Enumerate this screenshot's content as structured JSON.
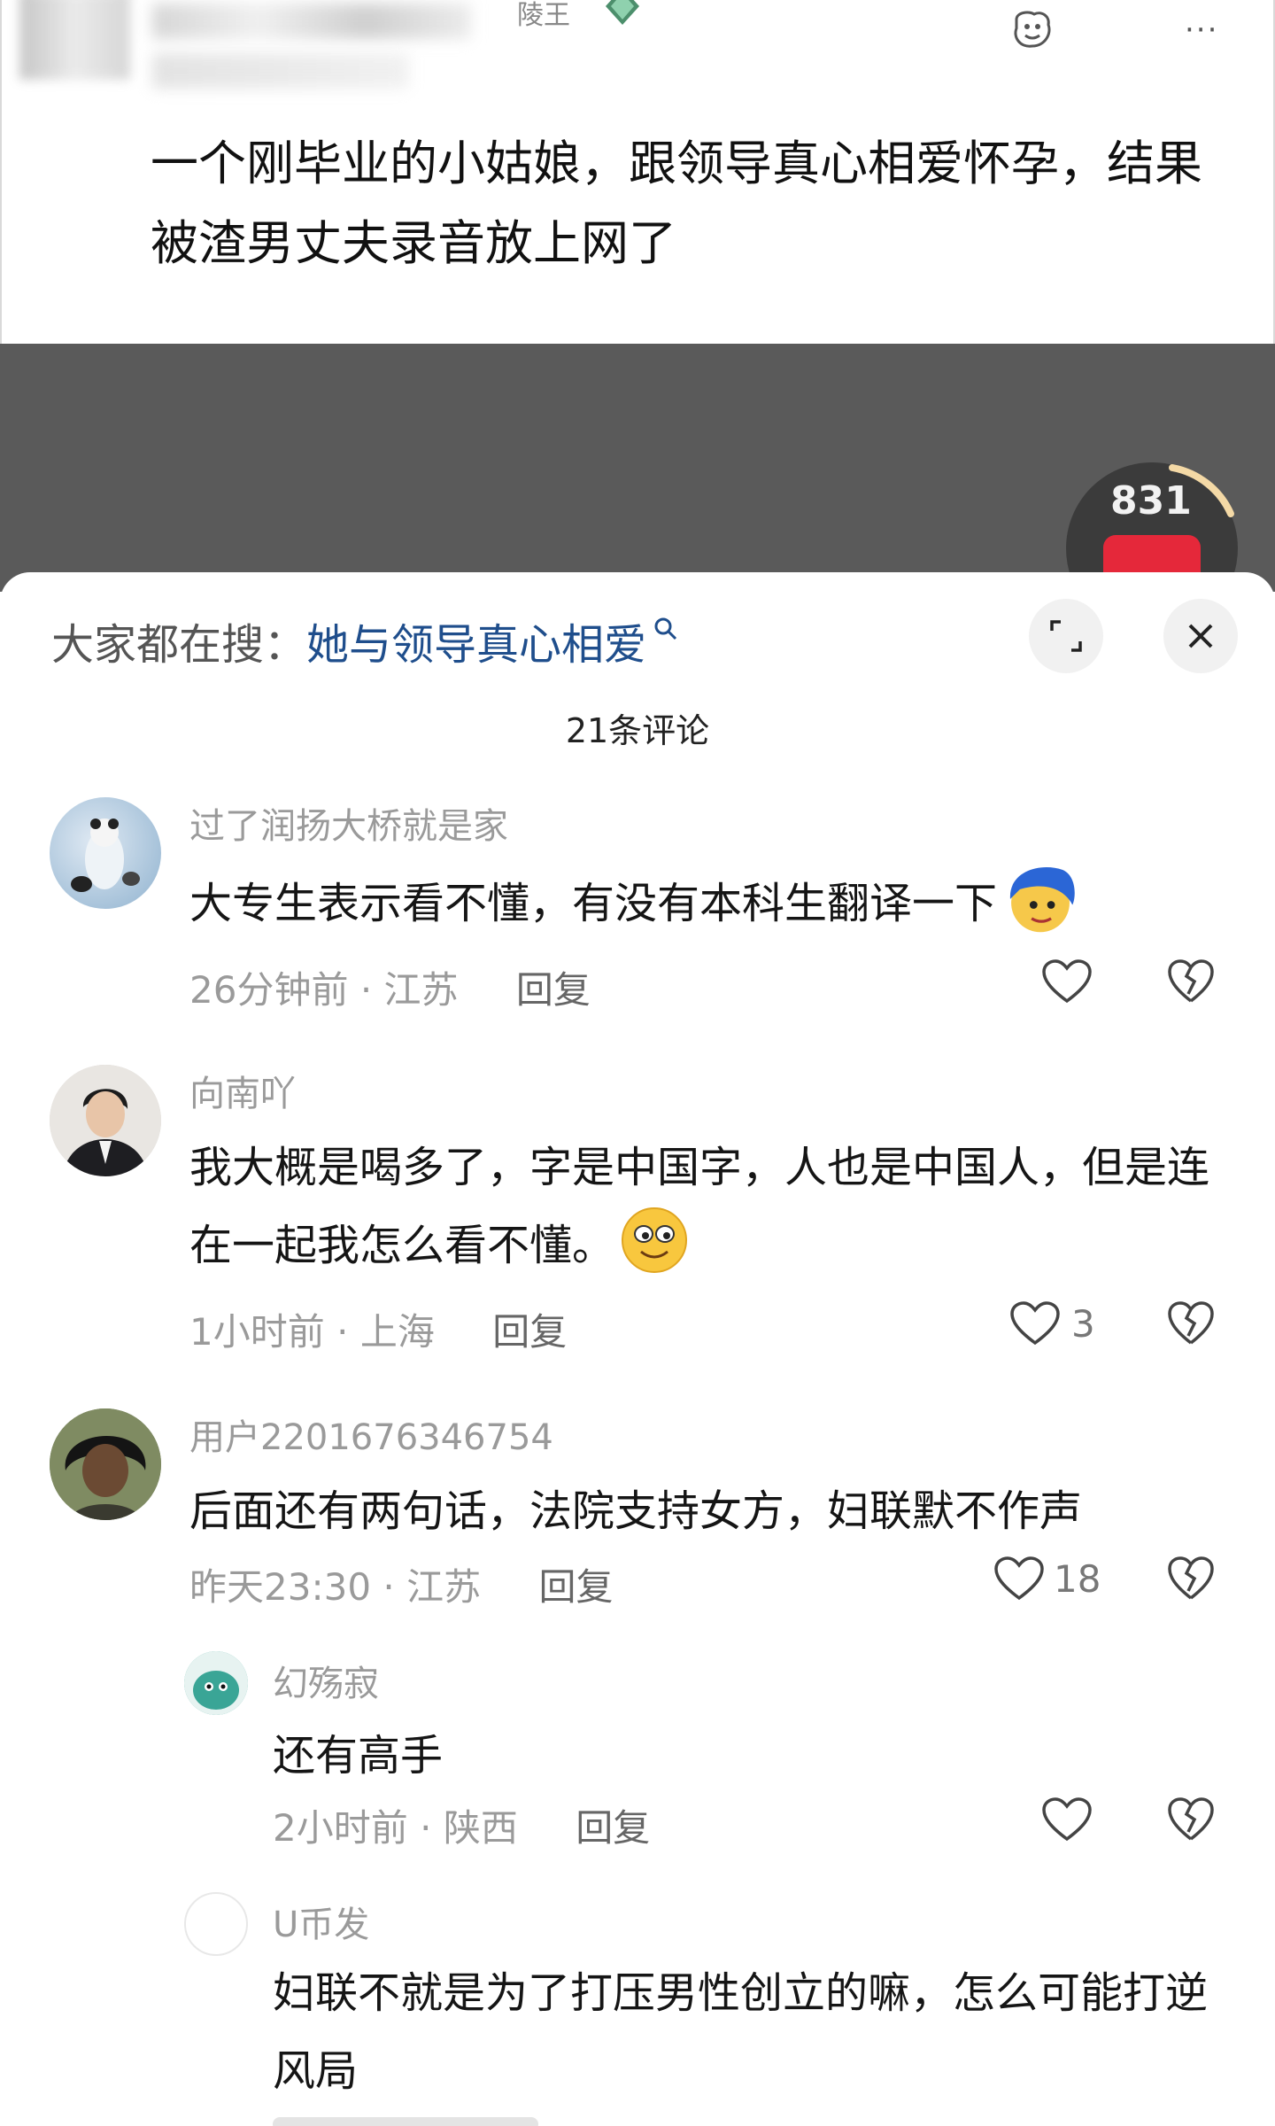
{
  "post": {
    "partial_tag": "陵王",
    "text": "一个刚毕业的小姑娘，跟领导真心相爱怀孕，结果被渣男丈夫录音放上网了",
    "like_count": "831"
  },
  "search_bar": {
    "prefix": "大家都在搜：",
    "query": "她与领导真心相爱"
  },
  "comments_header": "21条评论",
  "comments": [
    {
      "name": "过了润扬大桥就是家",
      "text": "大专生表示看不懂，有没有本科生翻译一下",
      "time": "26分钟前",
      "location": "江苏",
      "reply": "回复",
      "likes": ""
    },
    {
      "name": "向南吖",
      "text": "我大概是喝多了，字是中国字，人也是中国人，但是连在一起我怎么看不懂。",
      "time": "1小时前",
      "location": "上海",
      "reply": "回复",
      "likes": "3"
    },
    {
      "name": "用户2201676346754",
      "text": "后面还有两句话，法院支持女方，妇联默不作声",
      "time": "昨天23:30",
      "location": "江苏",
      "reply": "回复",
      "likes": "18"
    }
  ],
  "replies": [
    {
      "name": "幻殇寂",
      "text": "还有高手",
      "time": "2小时前",
      "location": "陕西",
      "reply": "回复",
      "likes": ""
    },
    {
      "name": "U币发",
      "text": "妇联不就是为了打压男性创立的嘛，怎么可能打逆风局"
    }
  ],
  "meta_separator": "·",
  "icons": {
    "expand": "expand-icon",
    "close": "close-icon",
    "like": "heart-icon",
    "dislike": "broken-heart-icon"
  },
  "colors": {
    "search_link": "#1f4e8c",
    "overlay": "#5a5a5a",
    "like_red": "#e5283a"
  }
}
